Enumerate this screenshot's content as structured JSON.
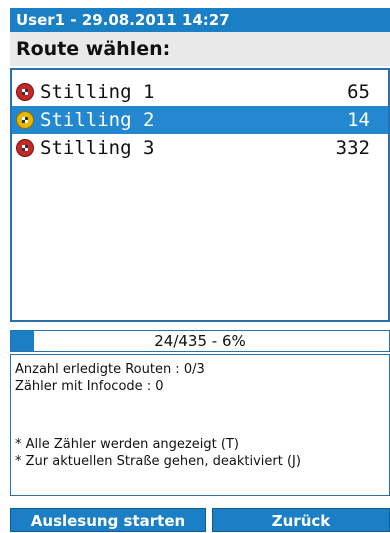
{
  "header": {
    "title": "User1 - 29.08.2011 14:27"
  },
  "heading": "Route wählen:",
  "routes": [
    {
      "name": "Stilling 1",
      "count": "65",
      "icon": "red-checkered-icon",
      "selected": false
    },
    {
      "name": "Stilling 2",
      "count": "14",
      "icon": "yellow-checkered-icon",
      "selected": true
    },
    {
      "name": "Stilling 3",
      "count": "332",
      "icon": "red-checkered-icon",
      "selected": false
    }
  ],
  "progress": {
    "label": "24/435 - 6%",
    "fraction": 0.06
  },
  "info": {
    "done_routes": "Anzahl erledigte Routen : 0/3",
    "infocode": "Zähler mit Infocode : 0",
    "note1": "* Alle Zähler werden angezeigt (T)",
    "note2": "* Zur aktuellen Straße gehen, deaktiviert (J)"
  },
  "buttons": {
    "start": "Auslesung starten",
    "back": "Zurück"
  },
  "colors": {
    "accent": "#1b7fc6",
    "selected_row": "#2388cf",
    "heading_bg": "#e9e9e9"
  }
}
